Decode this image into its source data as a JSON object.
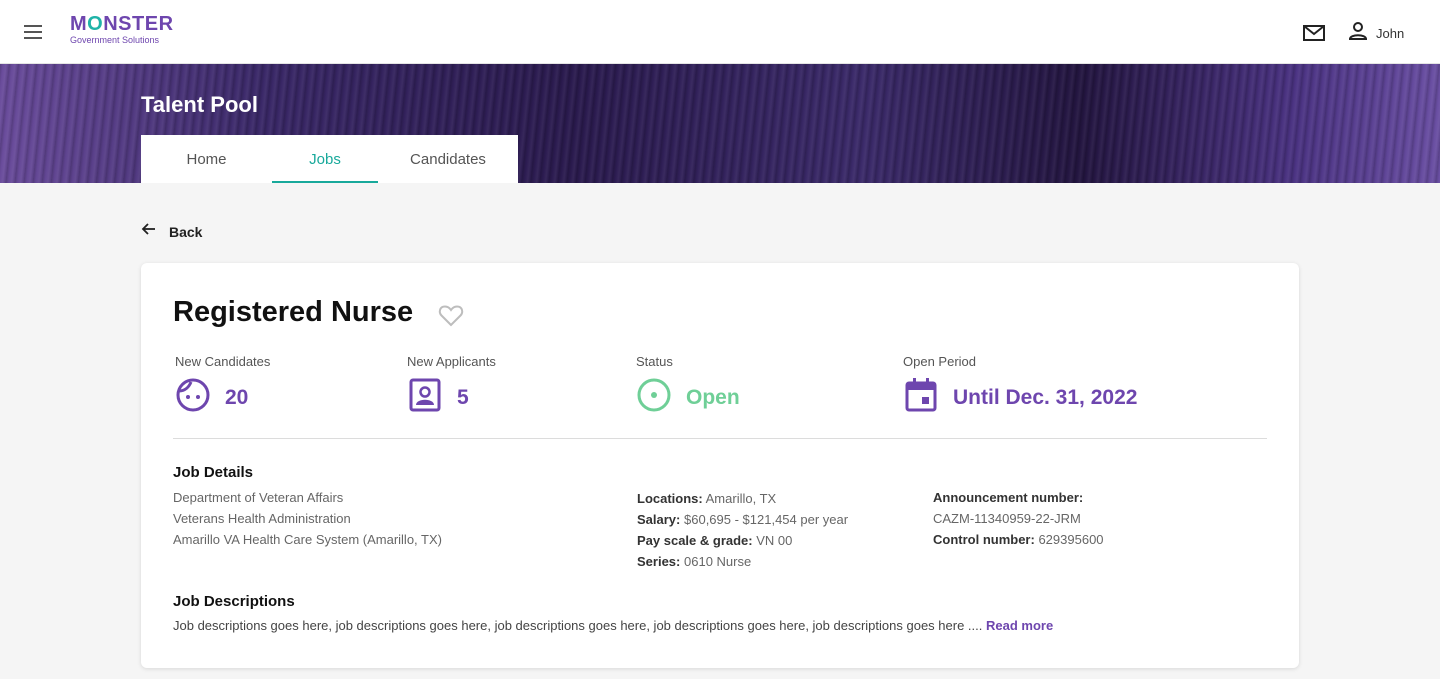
{
  "header": {
    "logo_main_pre": "M",
    "logo_main_o": "O",
    "logo_main_post": "NSTER",
    "logo_sub": "Government Solutions",
    "user_name": "John"
  },
  "banner": {
    "title": "Talent Pool",
    "tabs": [
      {
        "label": "Home",
        "active": false
      },
      {
        "label": "Jobs",
        "active": true
      },
      {
        "label": "Candidates",
        "active": false
      }
    ]
  },
  "back_label": "Back",
  "job": {
    "title": "Registered Nurse",
    "stats": {
      "new_candidates": {
        "label": "New Candidates",
        "value": "20"
      },
      "new_applicants": {
        "label": "New Applicants",
        "value": "5"
      },
      "status": {
        "label": "Status",
        "value": "Open"
      },
      "open_period": {
        "label": "Open Period",
        "value": "Until Dec. 31, 2022"
      }
    },
    "details": {
      "title": "Job Details",
      "org_lines": [
        "Department of Veteran Affairs",
        "Veterans Health Administration",
        "Amarillo VA Health Care System (Amarillo, TX)"
      ],
      "locations_label": "Locations:",
      "locations_value": "Amarillo, TX",
      "salary_label": "Salary:",
      "salary_value": "$60,695 - $121,454 per year",
      "pay_label": "Pay scale & grade:",
      "pay_value": "VN 00",
      "series_label": "Series:",
      "series_value": "0610 Nurse",
      "announcement_label": "Announcement number:",
      "announcement_value": "CAZM-11340959-22-JRM",
      "control_label": "Control number:",
      "control_value": "629395600"
    },
    "descriptions": {
      "title": "Job Descriptions",
      "text": "Job descriptions goes here, job descriptions goes here, job descriptions goes here, job descriptions goes here, job descriptions goes here ....",
      "read_more": "Read more"
    }
  },
  "colors": {
    "brand_purple": "#6e46ae",
    "teal": "#18a99b",
    "open_green": "#6fcf97"
  },
  "icons": [
    "menu-icon",
    "mail-icon",
    "user-icon",
    "arrow-left-icon",
    "heart-outline-icon",
    "face-icon",
    "contact-card-icon",
    "status-dot-icon",
    "calendar-icon"
  ]
}
